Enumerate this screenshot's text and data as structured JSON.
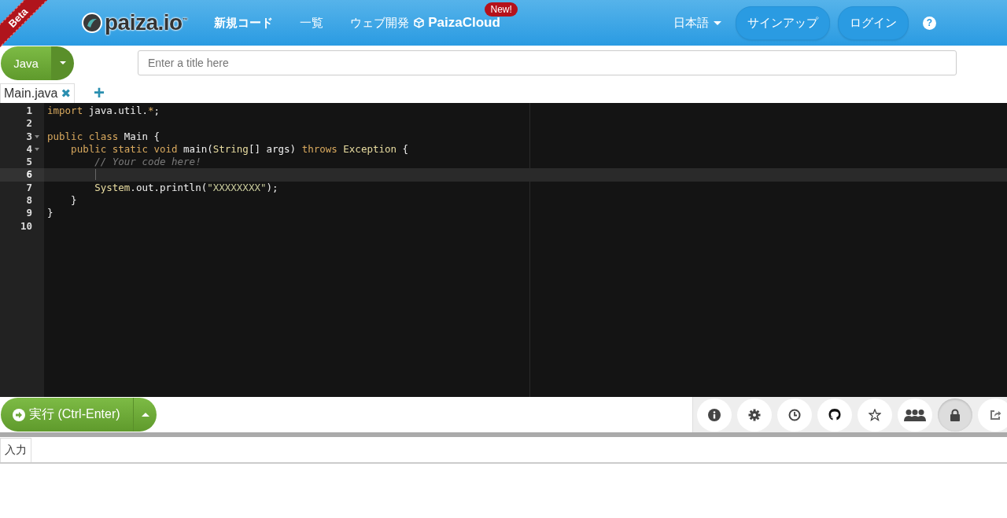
{
  "ribbon": "Beta",
  "header": {
    "logo": "paiza.io",
    "logo_mark": "™",
    "nav": [
      {
        "label": "新規コード",
        "kind": "link"
      },
      {
        "label": "一覧",
        "kind": "link"
      },
      {
        "label": "ウェブ開発",
        "kind": "link"
      },
      {
        "label": "PaizaCloud",
        "kind": "cloud",
        "badge": "New!"
      }
    ],
    "language": "日本語",
    "buttons": [
      "サインアップ",
      "ログイン"
    ],
    "help": "?"
  },
  "language_button": "Java",
  "title_field": {
    "placeholder": "Enter a title here"
  },
  "file_tabs": [
    {
      "label": "Main.java",
      "selected": true,
      "close": "✖"
    }
  ],
  "add_tab": "+",
  "editor": {
    "lines": [
      {
        "number": "1",
        "fold": false,
        "active": false,
        "tokens": [
          {
            "t": "import",
            "kind": "keyword"
          },
          {
            "t": " java.util.",
            "kind": "plain"
          },
          {
            "t": "*",
            "kind": "keyword"
          },
          {
            "t": ";",
            "kind": "plain"
          }
        ]
      },
      {
        "number": "2",
        "fold": false,
        "active": false
      },
      {
        "number": "3",
        "fold": true,
        "active": false,
        "tokens": [
          {
            "t": "public class ",
            "kind": "keyword"
          },
          {
            "t": "Main {",
            "kind": "plain"
          }
        ]
      },
      {
        "number": "4",
        "fold": true,
        "active": false,
        "tokens": [
          {
            "t": "    public static void ",
            "kind": "keyword"
          },
          {
            "t": "main(",
            "kind": "plain"
          },
          {
            "t": "String",
            "kind": "type"
          },
          {
            "t": "[] args) ",
            "kind": "plain"
          },
          {
            "t": "throws ",
            "kind": "keyword"
          },
          {
            "t": "Exception",
            "kind": "type"
          },
          {
            "t": " {",
            "kind": "plain"
          }
        ]
      },
      {
        "number": "5",
        "fold": false,
        "active": false,
        "tokens": [
          {
            "t": "        // Your code here!",
            "kind": "comment"
          }
        ]
      },
      {
        "number": "6",
        "fold": false,
        "active": true
      },
      {
        "number": "7",
        "fold": false,
        "active": false,
        "tokens": [
          {
            "t": "        System",
            "kind": "type"
          },
          {
            "t": ".out.println(",
            "kind": "plain"
          },
          {
            "t": "\"XXXXXXXX\"",
            "kind": "string"
          },
          {
            "t": ");",
            "kind": "plain"
          }
        ]
      },
      {
        "number": "8",
        "fold": false,
        "active": false,
        "tokens": [
          {
            "t": "    }",
            "kind": "plain"
          }
        ]
      },
      {
        "number": "9",
        "fold": false,
        "active": false,
        "tokens": [
          {
            "t": "}",
            "kind": "plain"
          }
        ]
      },
      {
        "number": "10",
        "fold": false,
        "active": false
      }
    ]
  },
  "run_button": "実行 (Ctrl-Enter)",
  "toolbar": [
    {
      "kind": "info",
      "selected": false
    },
    {
      "kind": "gear",
      "selected": false
    },
    {
      "kind": "clock",
      "selected": false
    },
    {
      "kind": "github",
      "selected": false
    },
    {
      "kind": "star",
      "selected": false
    },
    {
      "kind": "people",
      "selected": false
    },
    {
      "kind": "lock",
      "selected": true
    },
    {
      "kind": "share",
      "selected": false
    }
  ],
  "input_tab": {
    "label": "入力",
    "selected": true
  }
}
